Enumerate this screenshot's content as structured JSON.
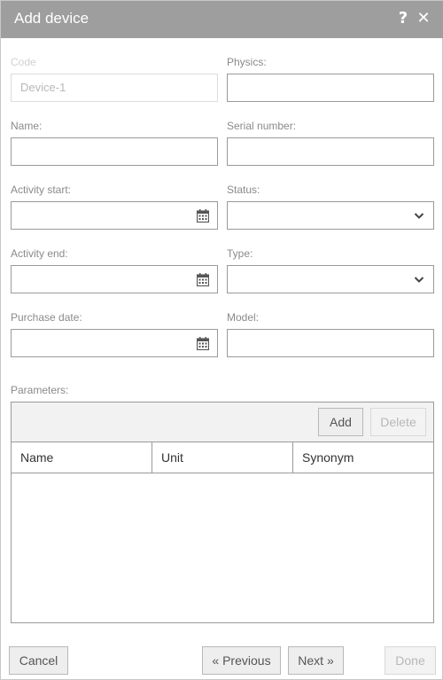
{
  "dialog": {
    "title": "Add device",
    "help_icon": "question-icon",
    "close_icon": "close-icon"
  },
  "form": {
    "code": {
      "label": "Code",
      "value": "Device-1",
      "disabled": true
    },
    "physics": {
      "label": "Physics:",
      "value": ""
    },
    "name": {
      "label": "Name:",
      "value": ""
    },
    "serial_number": {
      "label": "Serial number:",
      "value": ""
    },
    "activity_start": {
      "label": "Activity start:",
      "value": "",
      "icon": "calendar-icon"
    },
    "status": {
      "label": "Status:",
      "value": "",
      "icon": "chevron-down-icon"
    },
    "activity_end": {
      "label": "Activity end:",
      "value": "",
      "icon": "calendar-icon"
    },
    "type": {
      "label": "Type:",
      "value": "",
      "icon": "chevron-down-icon"
    },
    "purchase_date": {
      "label": "Purchase date:",
      "value": "",
      "icon": "calendar-icon"
    },
    "model": {
      "label": "Model:",
      "value": ""
    }
  },
  "parameters": {
    "label": "Parameters:",
    "add_label": "Add",
    "delete_label": "Delete",
    "columns": [
      "Name",
      "Unit",
      "Synonym"
    ],
    "rows": []
  },
  "footer": {
    "cancel_label": "Cancel",
    "previous_label": "« Previous",
    "next_label": "Next »",
    "done_label": "Done"
  },
  "colors": {
    "titlebar": "#9e9e9e",
    "border": "#9a9a9a",
    "label": "#8a8a8a",
    "disabled": "#d0d0d0"
  }
}
